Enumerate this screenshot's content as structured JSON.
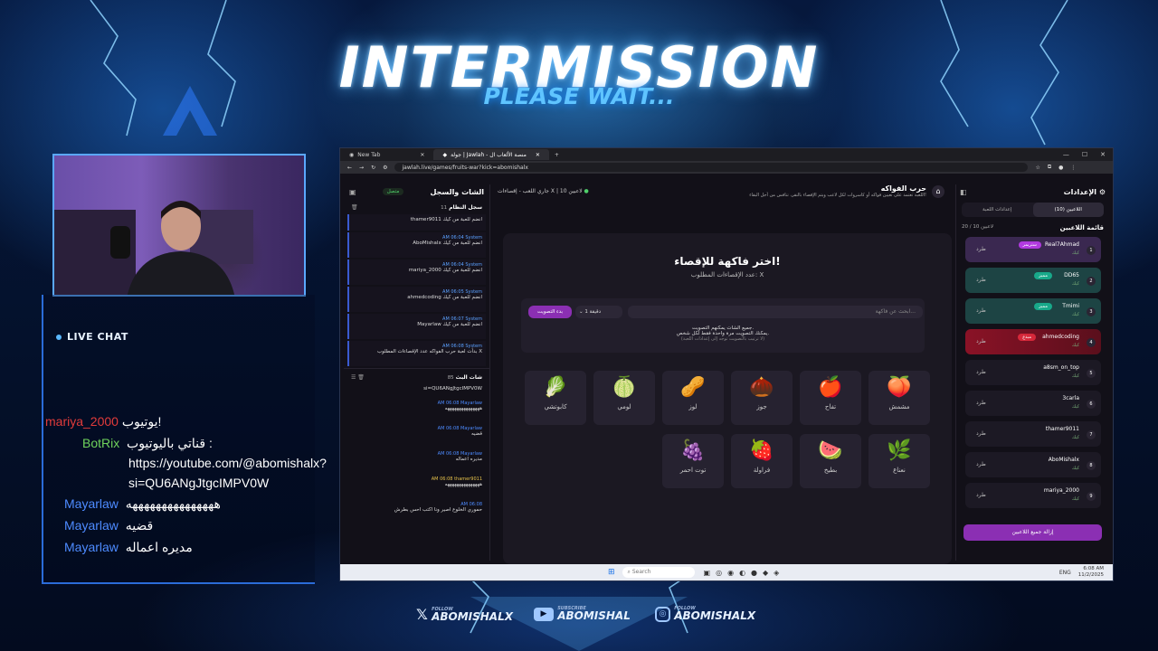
{
  "overlay": {
    "title": "INTERMISSION",
    "subtitle": "PLEASE WAIT...",
    "live_chat": "LIVE CHAT",
    "socials": [
      {
        "icon": "x-icon",
        "prefix": "FOLLOW",
        "handle": "ABOMISHALX"
      },
      {
        "icon": "youtube-icon",
        "prefix": "SUBSCRIBE",
        "handle": "ABOMISHAL"
      },
      {
        "icon": "instagram-icon",
        "prefix": "FOLLOW",
        "handle": "ABOMISHALX"
      }
    ],
    "chat": [
      {
        "user": "mariya_2000",
        "user_color": "#e23b3b",
        "text": "يوتيوب!"
      },
      {
        "user": "BotRix",
        "user_color": "#6fd35c",
        "text": "قناتي باليوتيوب :"
      },
      {
        "text": "https://youtube.com/@abomishalx?"
      },
      {
        "text": "si=QU6ANgJtgcIMPV0W"
      },
      {
        "user": "Mayarlaw",
        "user_color": "#4d8bff",
        "text": "هههههههههههههههه"
      },
      {
        "user": "Mayarlaw",
        "user_color": "#4d8bff",
        "text": "قضيه"
      },
      {
        "user": "Mayarlaw",
        "user_color": "#4d8bff",
        "text": "مديره اعماله"
      }
    ]
  },
  "browser": {
    "tabs": [
      {
        "label": "New Tab"
      },
      {
        "label": "جولة | Jawlah - منصة الألعاب ال"
      }
    ],
    "url": "jawlah.live/games/fruits-war?kick=abomishalx"
  },
  "app": {
    "left": {
      "header": "الشات والسجل",
      "status": "متصل",
      "log_title": "سجل النظام",
      "log_count": "11",
      "logs": [
        {
          "time": "",
          "text": "thamer9011 انضم للعبة من كيك"
        },
        {
          "time": "AM 06:04",
          "text": "AboMishalx انضم للعبة من كيك"
        },
        {
          "time": "AM 06:04",
          "text": "mariya_2000 انضم للعبة من كيك"
        },
        {
          "time": "AM 06:05",
          "text": "ahmedcoding انضم للعبة من كيك"
        },
        {
          "time": "AM 06:07",
          "text": "Mayarlaw انضم للعبة من كيك"
        },
        {
          "time": "AM 06:08",
          "text": "بدأت لعبة حرب الفواكه عدد الإقصاءات المطلوب X"
        }
      ],
      "chat_title": "شات البث",
      "chat_count": "85",
      "chat": [
        {
          "name": "",
          "time": "",
          "text": "si=QU6ANgJtgcIMPV0W"
        },
        {
          "name": "Mayarlaw",
          "time": "AM 06:08",
          "text": "هههههههههههههههه"
        },
        {
          "name": "Mayarlaw",
          "time": "AM 06:08",
          "text": "قضيه"
        },
        {
          "name": "Mayarlaw",
          "time": "AM 06:08",
          "text": "مديره اعماله"
        },
        {
          "name": "thamer9011",
          "time": "AM 06:08",
          "text": "هههههههههههههههه"
        },
        {
          "name": "",
          "time": "AM 06:08",
          "text": "حموري الخلوع اصير ونا اكتب احس بطرش"
        }
      ]
    },
    "center": {
      "title": "حرب الفواكه",
      "desc": "اللعبة تعتمد على تعيين فواكه أو كاسروات لكل لاعب ويتم الإقصاء بالنقر، تنافس من أجل البقاء!",
      "info_players": "10 لاعبين",
      "info_status": "جاري اللعب - إقصاءات X",
      "card_title": "اختر فاكهة للإقصاء!",
      "card_sub": "عدد الإقصاءات المطلوب: X",
      "search_placeholder": "ابحث عن فاكهة...",
      "duration": "1 دقيقة",
      "start_vote": "بدء التصويت",
      "note1": "جميع الشات يمكنهم التصويت.",
      "note2": "يمكنك التصويت مرة واحدة فقط لكل شخص.",
      "note3": "(لا ترتيب بالتصويت توجه إلى إعدادات اللعبة)",
      "fruits": [
        {
          "name": "مشمش",
          "emoji": "🍑"
        },
        {
          "name": "تفاح",
          "emoji": "🍎"
        },
        {
          "name": "جوز",
          "emoji": "🌰"
        },
        {
          "name": "لوز",
          "emoji": "🥜"
        },
        {
          "name": "لومي",
          "emoji": "🍈"
        },
        {
          "name": "كابوتشي",
          "emoji": "🥬"
        },
        {
          "name": "نعناع",
          "emoji": "🌿"
        },
        {
          "name": "بطيخ",
          "emoji": "🍉"
        },
        {
          "name": "فراولة",
          "emoji": "🍓"
        },
        {
          "name": "توت احمر",
          "emoji": "🍇"
        }
      ]
    },
    "right": {
      "header": "الإعدادات",
      "tab_players": "اللاعبين (10)",
      "tab_settings": "إعدادات اللعبة",
      "list_title": "قائمة اللاعبين",
      "count": "20 / 10 لاعبين",
      "kick_label": "طرد",
      "live_label": "كيك",
      "remove_all": "إزالة جميع اللاعبين",
      "players": [
        {
          "n": "1",
          "name": "Real7Ahmad",
          "badge": "ستريمر",
          "badge_color": "#b13ae0",
          "bg": "#3a2850"
        },
        {
          "n": "2",
          "name": "DD65",
          "badge": "مميز",
          "badge_color": "#18a98a",
          "bg": "#1d4444"
        },
        {
          "n": "3",
          "name": "Tmimi",
          "badge": "مميز",
          "badge_color": "#18a98a",
          "bg": "#1d4444"
        },
        {
          "n": "4",
          "name": "ahmedcoding",
          "badge": "مبدع",
          "badge_color": "#d6283a",
          "bg": "#6a1220"
        },
        {
          "n": "5",
          "name": "a8sm_on_top",
          "badge": "",
          "badge_color": "",
          "bg": "#1c1924"
        },
        {
          "n": "6",
          "name": "3carla",
          "badge": "",
          "badge_color": "",
          "bg": "#1c1924"
        },
        {
          "n": "7",
          "name": "thamer9011",
          "badge": "",
          "badge_color": "",
          "bg": "#1c1924"
        },
        {
          "n": "8",
          "name": "AboMishalx",
          "badge": "",
          "badge_color": "",
          "bg": "#1c1924"
        },
        {
          "n": "9",
          "name": "mariya_2000",
          "badge": "",
          "badge_color": "",
          "bg": "#1c1924"
        }
      ]
    }
  },
  "taskbar": {
    "search": "Search",
    "lang": "ENG",
    "time": "6:08 AM",
    "date": "11/2/2025"
  }
}
